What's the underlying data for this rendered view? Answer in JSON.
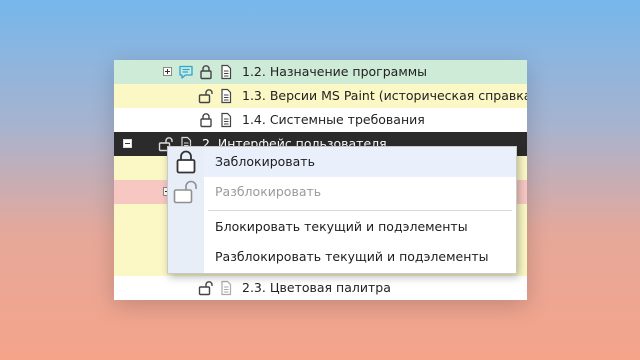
{
  "tree": {
    "rows": [
      {
        "label": "1.2. Назначение программы",
        "bg": "#cdebd6"
      },
      {
        "label": "1.3. Версии MS Paint (историческая справка)",
        "bg": "#fbf8c6"
      },
      {
        "label": "1.4. Системные требования",
        "bg": "#ffffff"
      },
      {
        "label": "2. Интерфейс пользователя",
        "bg": "#2b2b2b"
      },
      {
        "label": "",
        "bg": "#fbf8c6"
      },
      {
        "label": "",
        "bg": "#f7c7c2"
      },
      {
        "label": "",
        "bg": "#fbf8c6"
      },
      {
        "label": "",
        "bg": "#fbf8c6"
      },
      {
        "label": "",
        "bg": "#fbf8c6"
      },
      {
        "label": "2.3. Цветовая палитра",
        "bg": "#ffffff"
      }
    ]
  },
  "context_menu": {
    "lock_label": "Заблокировать",
    "unlock_label": "Разблокировать",
    "lock_children_label": "Блокировать текущий и подэлементы",
    "unlock_children_label": "Разблокировать текущий и подэлементы"
  },
  "colors": {
    "comment_icon": "#2aa4d9",
    "menu_gutter": "#e7eef8",
    "selected_row": "#2b2b2b"
  },
  "icons": [
    "plus-expander-icon",
    "minus-expander-icon",
    "comment-icon",
    "lock-icon",
    "unlock-icon",
    "document-icon"
  ]
}
